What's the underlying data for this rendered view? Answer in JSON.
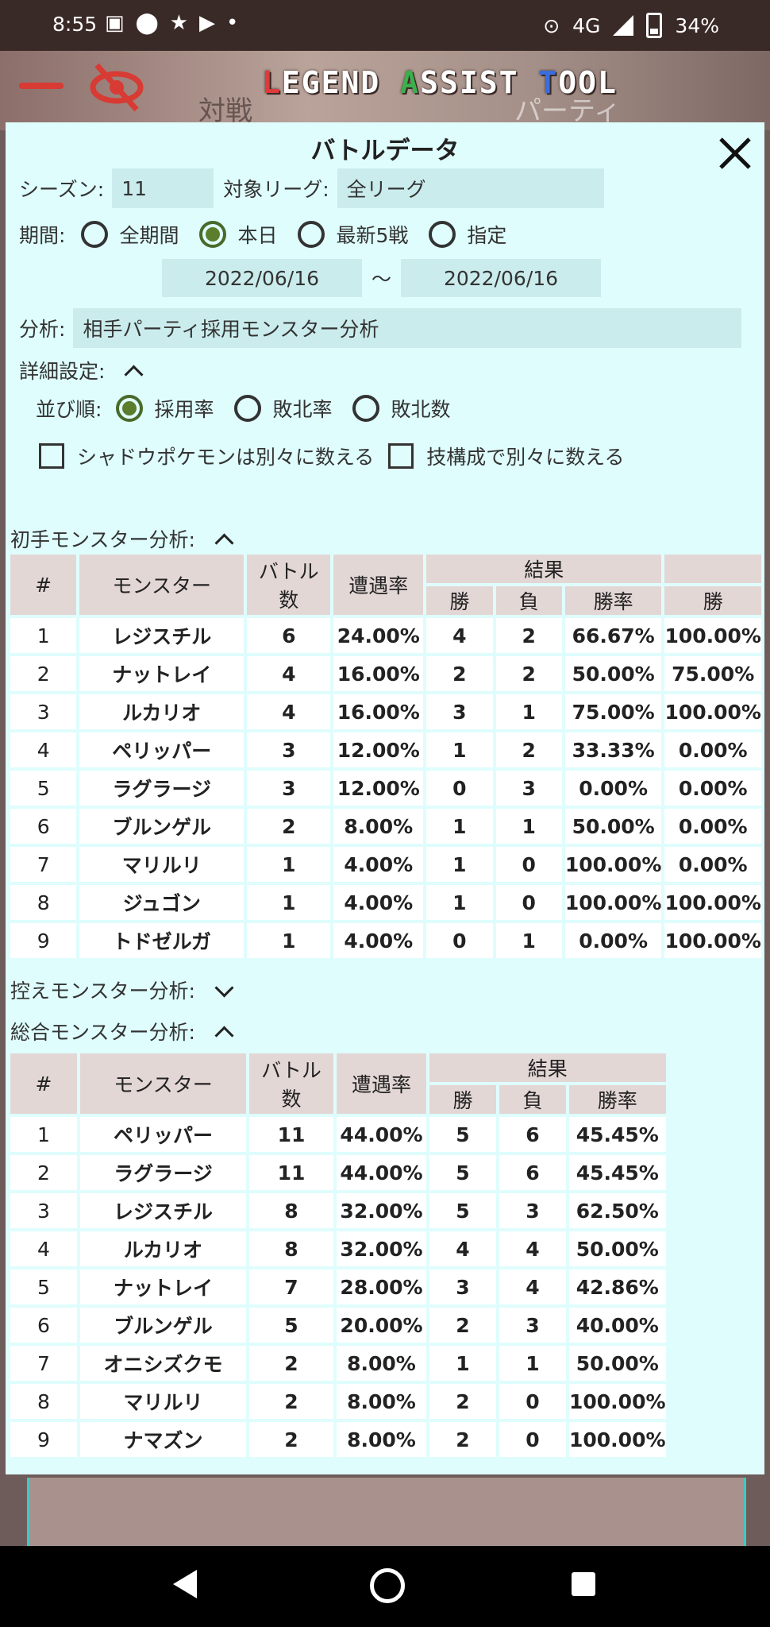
{
  "status": {
    "time": "8:55",
    "network": "4G",
    "battery": "34%"
  },
  "app": {
    "logo": {
      "p1": "L",
      "p2": "EGEND ",
      "p3": "A",
      "p4": "SSIST ",
      "p5": "T",
      "p6": "OOL"
    },
    "tab_battle": "対戦",
    "tab_party": "パーティ"
  },
  "modal": {
    "title": "バトルデータ",
    "season_label": "シーズン:",
    "season_value": "11",
    "league_label": "対象リーグ:",
    "league_value": "全リーグ",
    "period_label": "期間:",
    "period_options": [
      "全期間",
      "本日",
      "最新5戦",
      "指定"
    ],
    "period_selected": 1,
    "date_from": "2022/06/16",
    "date_sep": "〜",
    "date_to": "2022/06/16",
    "analysis_label": "分析:",
    "analysis_value": "相手パーティ採用モンスター分析",
    "detail_label": "詳細設定:",
    "sort_label": "並び順:",
    "sort_options": [
      "採用率",
      "敗北率",
      "敗北数"
    ],
    "sort_selected": 0,
    "check_shadow": "シャドウポケモンは別々に数える",
    "check_moves": "技構成で別々に数える",
    "lead_section": "初手モンスター分析:",
    "bench_section": "控えモンスター分析:",
    "total_section": "総合モンスター分析:"
  },
  "lead_table": {
    "headers": {
      "num": "#",
      "monster": "モンスター",
      "battles1": "バトル",
      "battles2": "数",
      "rate": "遭遇率",
      "result": "結果",
      "win": "勝",
      "lose": "負",
      "winrate": "勝率",
      "extra": "勝"
    },
    "rows": [
      [
        "1",
        "レジスチル",
        "6",
        "24.00%",
        "4",
        "2",
        "66.67%",
        "100.00%"
      ],
      [
        "2",
        "ナットレイ",
        "4",
        "16.00%",
        "2",
        "2",
        "50.00%",
        "75.00%"
      ],
      [
        "3",
        "ルカリオ",
        "4",
        "16.00%",
        "3",
        "1",
        "75.00%",
        "100.00%"
      ],
      [
        "4",
        "ペリッパー",
        "3",
        "12.00%",
        "1",
        "2",
        "33.33%",
        "0.00%"
      ],
      [
        "5",
        "ラグラージ",
        "3",
        "12.00%",
        "0",
        "3",
        "0.00%",
        "0.00%"
      ],
      [
        "6",
        "ブルンゲル",
        "2",
        "8.00%",
        "1",
        "1",
        "50.00%",
        "0.00%"
      ],
      [
        "7",
        "マリルリ",
        "1",
        "4.00%",
        "1",
        "0",
        "100.00%",
        "0.00%"
      ],
      [
        "8",
        "ジュゴン",
        "1",
        "4.00%",
        "1",
        "0",
        "100.00%",
        "100.00%"
      ],
      [
        "9",
        "トドゼルガ",
        "1",
        "4.00%",
        "0",
        "1",
        "0.00%",
        "100.00%"
      ]
    ]
  },
  "total_table": {
    "headers": {
      "num": "#",
      "monster": "モンスター",
      "battles1": "バトル",
      "battles2": "数",
      "rate": "遭遇率",
      "result": "結果",
      "win": "勝",
      "lose": "負",
      "winrate": "勝率"
    },
    "rows": [
      [
        "1",
        "ペリッパー",
        "11",
        "44.00%",
        "5",
        "6",
        "45.45%"
      ],
      [
        "2",
        "ラグラージ",
        "11",
        "44.00%",
        "5",
        "6",
        "45.45%"
      ],
      [
        "3",
        "レジスチル",
        "8",
        "32.00%",
        "5",
        "3",
        "62.50%"
      ],
      [
        "4",
        "ルカリオ",
        "8",
        "32.00%",
        "4",
        "4",
        "50.00%"
      ],
      [
        "5",
        "ナットレイ",
        "7",
        "28.00%",
        "3",
        "4",
        "42.86%"
      ],
      [
        "6",
        "ブルンゲル",
        "5",
        "20.00%",
        "2",
        "3",
        "40.00%"
      ],
      [
        "7",
        "オニシズクモ",
        "2",
        "8.00%",
        "1",
        "1",
        "50.00%"
      ],
      [
        "8",
        "マリルリ",
        "2",
        "8.00%",
        "2",
        "0",
        "100.00%"
      ],
      [
        "9",
        "ナマズン",
        "2",
        "8.00%",
        "2",
        "0",
        "100.00%"
      ]
    ]
  }
}
